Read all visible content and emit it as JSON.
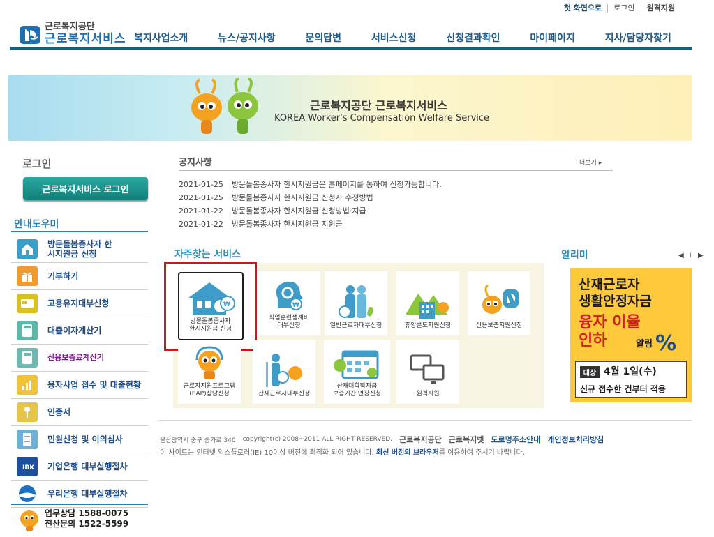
{
  "util_links": [
    "첫 화면으로",
    "로그인",
    "원격지원"
  ],
  "logo": {
    "sub": "근로복지공단",
    "main": "근로복지서비스"
  },
  "gnb": [
    "복지사업소개",
    "뉴스/공지사항",
    "문의답변",
    "서비스신청",
    "신청결과확인",
    "마이페이지",
    "지사/담당자찾기"
  ],
  "banner": {
    "title": "근로복지공단 근로복지서비스",
    "subtitle": "KOREA Worker's Compensation Welfare Service"
  },
  "login": {
    "title": "로그인",
    "button": "근로복지서비스 로그인"
  },
  "guide": {
    "title": "안내도우미",
    "items": [
      {
        "label": "방문돌봄종사자 한시지원금 신청",
        "icon": "house-icon"
      },
      {
        "label": "기부하기",
        "icon": "gift-icon"
      },
      {
        "label": "고용유지대부신청",
        "icon": "card-icon"
      },
      {
        "label": "대출이자계산기",
        "icon": "calculator-icon"
      },
      {
        "label": "신용보증료계산기",
        "icon": "calculator-icon"
      },
      {
        "label": "융자사업 접수 및 대출현황",
        "icon": "chart-icon"
      },
      {
        "label": "인증서",
        "icon": "key-icon"
      },
      {
        "label": "민원신청 및 이의심사",
        "icon": "document-icon"
      },
      {
        "label": "기업은행 대부실행절차",
        "icon": "ibk-icon"
      },
      {
        "label": "우리은행 대부실행절차",
        "icon": "woori-icon"
      }
    ]
  },
  "contact": {
    "line1": "업무상담 1588-0075",
    "line2": "전산문의 1522-5599"
  },
  "notice": {
    "title": "공지사항",
    "more": "더보기",
    "items": [
      {
        "date": "2021-01-25",
        "text": "방문돌봄종사자 한시지원금은 홈페이지를 통하여 신청가능합니다."
      },
      {
        "date": "2021-01-25",
        "text": "방문돌봄종사자 한시지원금 신청자 수정방법"
      },
      {
        "date": "2021-01-22",
        "text": "방문돌봄종사자 한시지원금 신청방법·지급"
      },
      {
        "date": "2021-01-22",
        "text": "방문돌봄종사자 한시지원금 지원금"
      }
    ]
  },
  "favorites": {
    "title": "자주찾는 서비스",
    "tiles": [
      {
        "label": "방문돌봄종사자\n한시지원금 신청",
        "icon": "house-coin-icon"
      },
      {
        "label": "직업훈련생계비\n대부신청",
        "icon": "head-gear-icon"
      },
      {
        "label": "일반근로자대부신청",
        "icon": "people-icon"
      },
      {
        "label": "휴양콘도지원신청",
        "icon": "mountain-building-icon"
      },
      {
        "label": "신용보증지원신청",
        "icon": "mascot-shield-icon"
      },
      {
        "label": "근로자지원프로그램\n(EAP)상담신청",
        "icon": "mascot-headset-icon"
      },
      {
        "label": "산재근로자대부신청",
        "icon": "crutch-worker-icon"
      },
      {
        "label": "산재대학학자금\n보증기간 연장신청",
        "icon": "calendar-icon"
      },
      {
        "label": "원격지원",
        "icon": "monitor-icon"
      }
    ]
  },
  "alimi": {
    "title": "알리미",
    "controls": "◀ ॥ ▶",
    "line1": "산재근로자",
    "line2": "생활안정자금",
    "line3": "융자 이율",
    "line4": "인하",
    "line5": "알림",
    "tag": "대상",
    "date": "4월 1일(수)",
    "desc": "신규 접수한 건부터 적용"
  },
  "footer": {
    "address": "울산광역시 중구 종가로 340",
    "copyright": "copyright(c) 2008~2011 ALL RIGHT RESERVED.",
    "org1": "근로복지공단",
    "org2": "근로복지넷",
    "road": "도로명주소안내",
    "privacy": "개인정보처리방침",
    "notice_pre": "이 사이트는 인터넷 익스플로러(IE) 10이상 버전에 최적화 되어 있습니다.",
    "notice_bold": "최신 버전의 브라우저",
    "notice_post": "를 이용하여 주시기 바랍니다."
  },
  "colors": {
    "brand": "#1a5e7a",
    "accent_blue": "#2b8fb8",
    "highlight": "#d4141d",
    "alimi_bg": "#fec93b"
  }
}
